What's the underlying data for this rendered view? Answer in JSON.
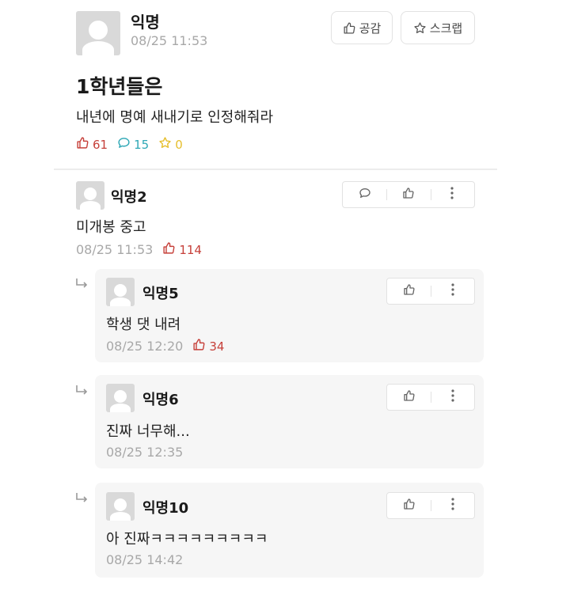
{
  "post": {
    "author": "익명",
    "datetime": "08/25 11:53",
    "title": "1학년들은",
    "body": "내년에 명예 새내기로 인정해줘라",
    "likes": "61",
    "comments": "15",
    "scraps": "0",
    "vote_button_label": "공감",
    "scrap_button_label": "스크랩"
  },
  "comments": [
    {
      "author": "익명2",
      "text": "미개봉 중고",
      "datetime": "08/25 11:53",
      "likes": "114"
    }
  ],
  "replies": [
    {
      "author": "익명5",
      "text": "학생 댓 내려",
      "datetime": "08/25 12:20",
      "likes": "34"
    },
    {
      "author": "익명6",
      "text": "진짜 너무해...",
      "datetime": "08/25 12:35"
    },
    {
      "author": "익명10",
      "text": "아 진짜ㅋㅋㅋㅋㅋㅋㅋㅋㅋ",
      "datetime": "08/25 14:42"
    }
  ],
  "colors": {
    "like": "#c6403a",
    "comment": "#2fa8b6",
    "scrap": "#e6bf2e",
    "meta": "#a8a8a8"
  }
}
